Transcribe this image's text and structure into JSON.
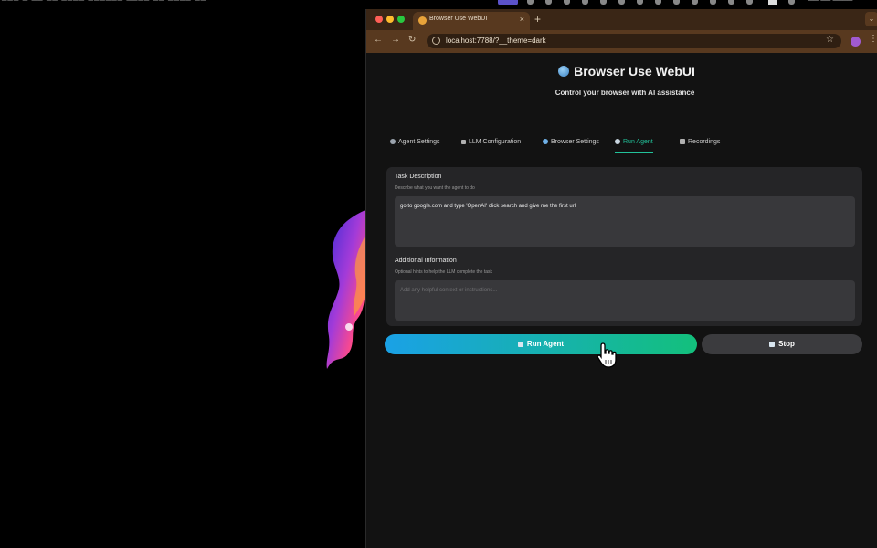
{
  "menubar": {
    "left_text": "━━━  ━  ━━  ━━  ━━━━  ━━━━━━  ━━━━  ━━  ━━━━  ━━",
    "clock_text": "━━ ━━ ━━━━"
  },
  "browser": {
    "tab_title": "Browser Use WebUI",
    "tab_close": "×",
    "new_tab": "+",
    "tab_menu": "⌄",
    "back": "←",
    "forward": "→",
    "reload": "↻",
    "url": "localhost:7788/?__theme=dark",
    "star": "☆",
    "kebab": "⋮"
  },
  "app": {
    "title": "Browser Use WebUI",
    "subtitle": "Control your browser with AI assistance",
    "tabs": [
      {
        "label": "Agent Settings",
        "icon": "gear-icon"
      },
      {
        "label": "LLM Configuration",
        "icon": "wrench-icon"
      },
      {
        "label": "Browser Settings",
        "icon": "globe-icon"
      },
      {
        "label": "Run Agent",
        "icon": "robot-icon"
      },
      {
        "label": "Recordings",
        "icon": "film-icon"
      }
    ],
    "active_tab": "Run Agent",
    "task": {
      "label": "Task Description",
      "hint": "Describe what you want the agent to do",
      "value": "go to google.com and type 'OpenAI' click search and give me the first url"
    },
    "additional": {
      "label": "Additional Information",
      "hint": "Optional hints to help the LLM complete the task",
      "placeholder": "Add any helpful context or instructions..."
    },
    "run_button": "Run Agent",
    "stop_button": "Stop"
  },
  "colors": {
    "accent": "#22c29a",
    "run_gradient_start": "#1aa1e6",
    "run_gradient_end": "#13c07c",
    "chrome_brown": "#58391f"
  }
}
